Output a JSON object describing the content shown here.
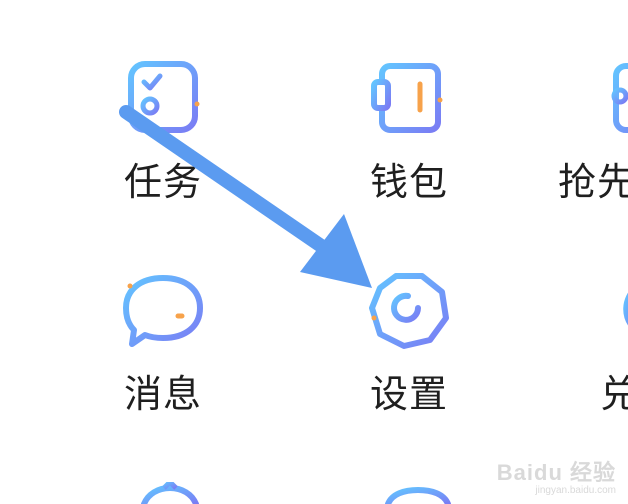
{
  "grid": {
    "items": [
      {
        "label": "任务",
        "icon": "task-checklist-icon"
      },
      {
        "label": "钱包",
        "icon": "wallet-icon"
      },
      {
        "label": "抢先",
        "icon": "grab-first-icon"
      },
      {
        "label": "消息",
        "icon": "message-bubble-icon"
      },
      {
        "label": "设置",
        "icon": "settings-icon"
      },
      {
        "label": "兑",
        "icon": "redeem-icon"
      }
    ]
  },
  "annotation": {
    "icon": "arrow-icon",
    "color": "#5b9bf0",
    "points_to": "设置"
  },
  "colors": {
    "icon_gradient_start": "#66c0ff",
    "icon_gradient_end": "#7b7ff5",
    "accent_orange": "#f7a24a",
    "label_text": "#1f1f1f"
  },
  "watermark": {
    "logo": "Baidu 经验",
    "url": "jingyan.baidu.com"
  }
}
